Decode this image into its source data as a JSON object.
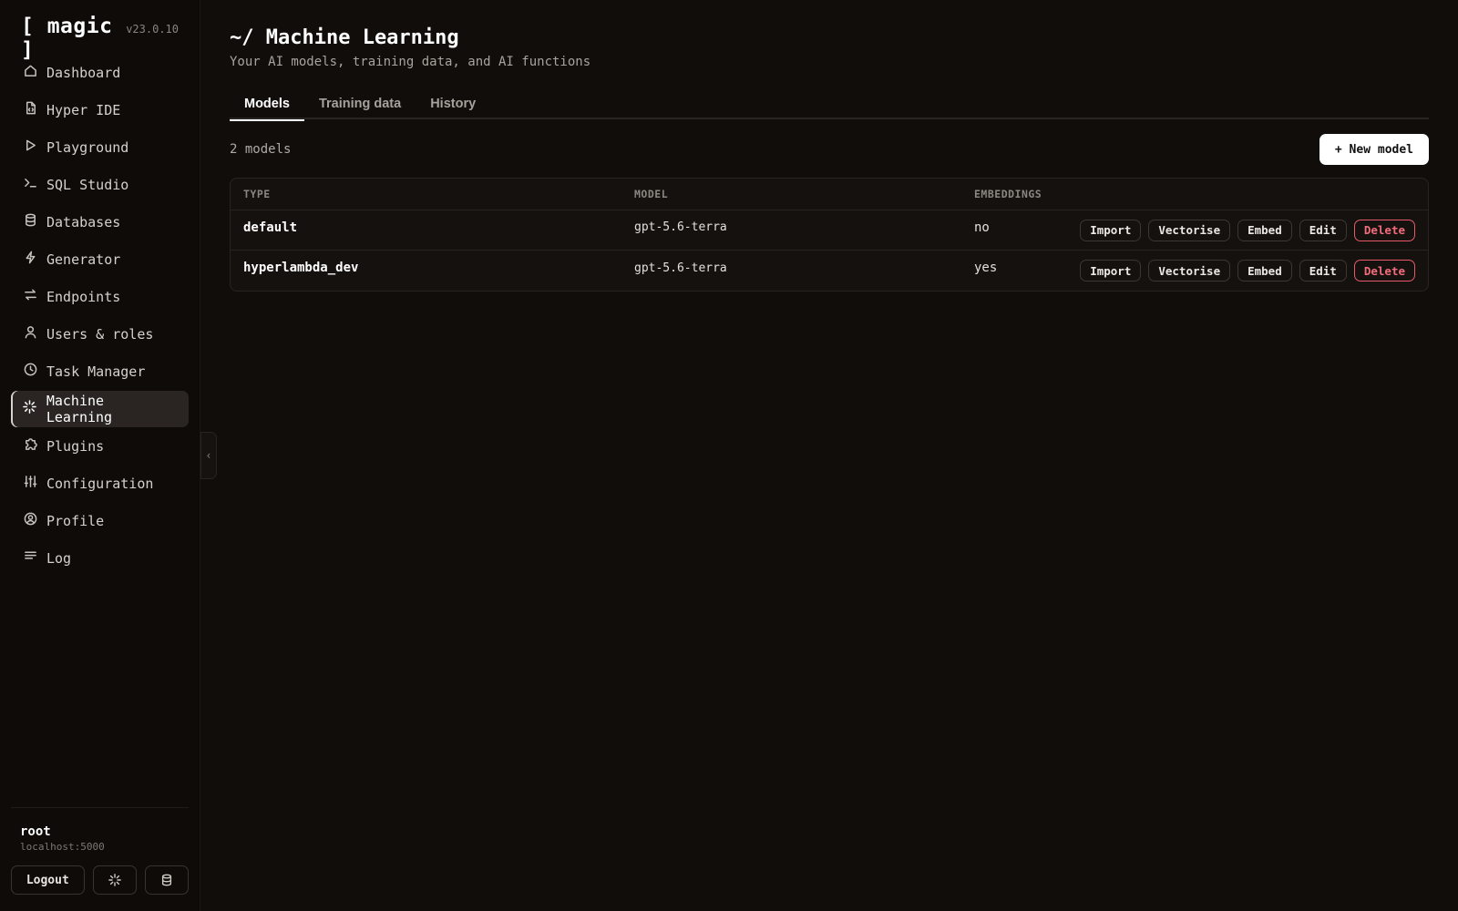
{
  "brand": {
    "name": "[ magic ]",
    "version": "v23.0.10"
  },
  "nav": [
    {
      "label": "Dashboard",
      "icon": "home-icon"
    },
    {
      "label": "Hyper IDE",
      "icon": "code-file-icon"
    },
    {
      "label": "Playground",
      "icon": "play-icon"
    },
    {
      "label": "SQL Studio",
      "icon": "terminal-icon"
    },
    {
      "label": "Databases",
      "icon": "database-icon"
    },
    {
      "label": "Generator",
      "icon": "bolt-icon"
    },
    {
      "label": "Endpoints",
      "icon": "arrows-exchange-icon"
    },
    {
      "label": "Users & roles",
      "icon": "user-icon"
    },
    {
      "label": "Task Manager",
      "icon": "clock-icon"
    },
    {
      "label": "Machine Learning",
      "icon": "sparkle-icon",
      "active": true
    },
    {
      "label": "Plugins",
      "icon": "puzzle-icon"
    },
    {
      "label": "Configuration",
      "icon": "sliders-icon"
    },
    {
      "label": "Profile",
      "icon": "user-circle-icon"
    },
    {
      "label": "Log",
      "icon": "list-lines-icon"
    }
  ],
  "footer": {
    "user": "root",
    "host": "localhost:5000",
    "logout_label": "Logout"
  },
  "page": {
    "title": "~/ Machine Learning",
    "subtitle": "Your AI models, training data, and AI functions"
  },
  "tabs": [
    {
      "label": "Models",
      "active": true
    },
    {
      "label": "Training data"
    },
    {
      "label": "History"
    }
  ],
  "toolbar": {
    "count": "2 models",
    "new_label": "+ New model"
  },
  "table": {
    "headers": {
      "type": "TYPE",
      "model": "MODEL",
      "embeddings": "EMBEDDINGS"
    },
    "actions": {
      "import": "Import",
      "vectorise": "Vectorise",
      "embed": "Embed",
      "edit": "Edit",
      "delete": "Delete"
    },
    "rows": [
      {
        "type": "default",
        "model": "gpt-5.6-terra",
        "embeddings": "no"
      },
      {
        "type": "hyperlambda_dev",
        "model": "gpt-5.6-terra",
        "embeddings": "yes"
      }
    ]
  },
  "colors": {
    "background": "#110d0b",
    "sidebar": "#0e0b09",
    "accent": "#ffffff",
    "danger": "#f26d7c"
  }
}
